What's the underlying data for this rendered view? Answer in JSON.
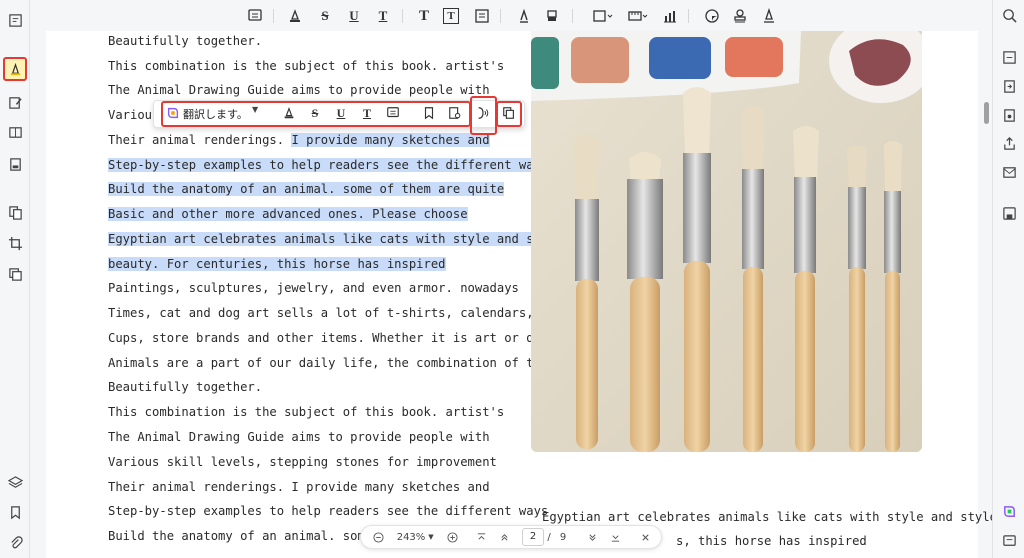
{
  "toolbar": {
    "icons": [
      "comment-icon",
      "highlight-icon",
      "strikethrough-icon",
      "underline-icon",
      "text-underline-icon",
      "text-icon",
      "textbox-icon",
      "callout-icon",
      "pencil-icon",
      "eraser-icon",
      "shape-icon",
      "measure-icon",
      "chart-icon",
      "sticker-icon",
      "stamp-icon",
      "signature-icon"
    ],
    "strike_label": "S",
    "underline_label": "U",
    "textcolor_label": "T",
    "text_label": "T",
    "textbox_label": "T"
  },
  "document": {
    "lines": [
      "Beautifully together.",
      "This combination is the subject of this book. artist's",
      "The Animal Drawing Guide aims to provide people with",
      "Various",
      "Their animal renderings. ",
      "I provide many sketches and",
      "Step-by-step examples to help readers see the different ways",
      "Build the anatomy of an animal. some of them are quite",
      "Basic and other more advanced ones. Please choose",
      "Egyptian art celebrates animals like cats with style and style",
      "beauty. For centuries, this horse has inspired",
      "Paintings, sculptures, jewelry, and even armor. nowadays",
      "Times, cat and dog art sells a lot of t-shirts, calendars, coffee",
      "Cups, store brands and other items. Whether it is art or domestic",
      "Animals are a part of our daily life, the combination of the two",
      "Beautifully together.",
      "This combination is the subject of this book. artist's",
      "The Animal Drawing Guide aims to provide people with",
      "Various skill levels, stepping stones for improvement",
      "Their animal renderings. I provide many sketches and",
      "Step-by-step examples to help readers see the different ways",
      "Build the anatomy of an animal. some of th"
    ],
    "caption_lines": [
      "Egyptian art celebrates animals like cats with style and style",
      "s, this horse has inspired"
    ]
  },
  "selection_toolbar": {
    "translate_label": "翻訳します。",
    "strike_label": "S",
    "underline_label": "U",
    "textcolor_label": "T"
  },
  "page_nav": {
    "zoom": "243%",
    "current_page": "2",
    "separator": "/",
    "total_pages": "9"
  },
  "colors": {
    "highlight": "#c8dcfa",
    "annotation_red": "#e53935",
    "active_tool_bg": "#fff3b3"
  }
}
